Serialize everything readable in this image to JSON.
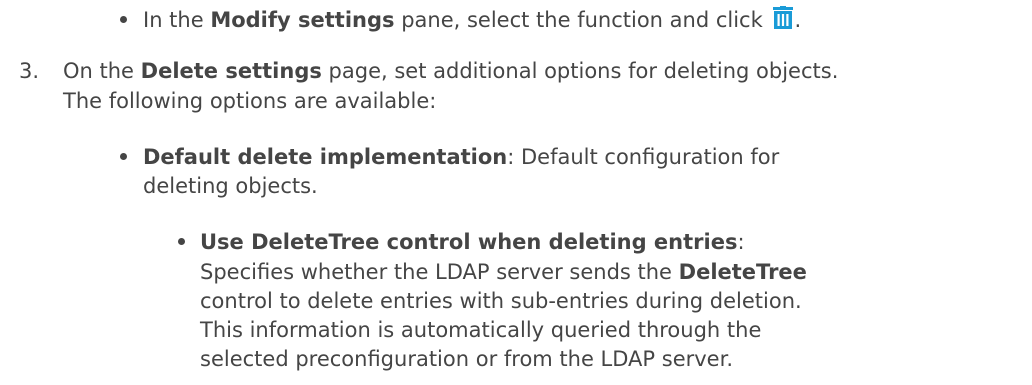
{
  "accent_color": "#1a9bd7",
  "step_bullet": {
    "pre": "In the ",
    "bold": "Modify settings",
    "post": " pane, select the function and click ",
    "icon": "trash-icon",
    "tail": "."
  },
  "step3": {
    "number": "3.",
    "line1_pre": "On the ",
    "line1_bold": "Delete settings",
    "line1_post": " page, set additional options for deleting objects.",
    "line2": "The following options are available:"
  },
  "option_default": {
    "bold": "Default delete implementation",
    "line1_post": ": Default configuration for",
    "line2": "deleting objects."
  },
  "option_deletetree": {
    "bold": "Use DeleteTree control when deleting entries",
    "bold_tail": ":",
    "line2": "Specifies whether the LDAP server sends the ",
    "line2_bold": "DeleteTree",
    "line3": "control to delete entries with sub-entries during deletion.",
    "line4": "This information is automatically queried through the",
    "line5": "selected preconfiguration or from the LDAP server."
  }
}
